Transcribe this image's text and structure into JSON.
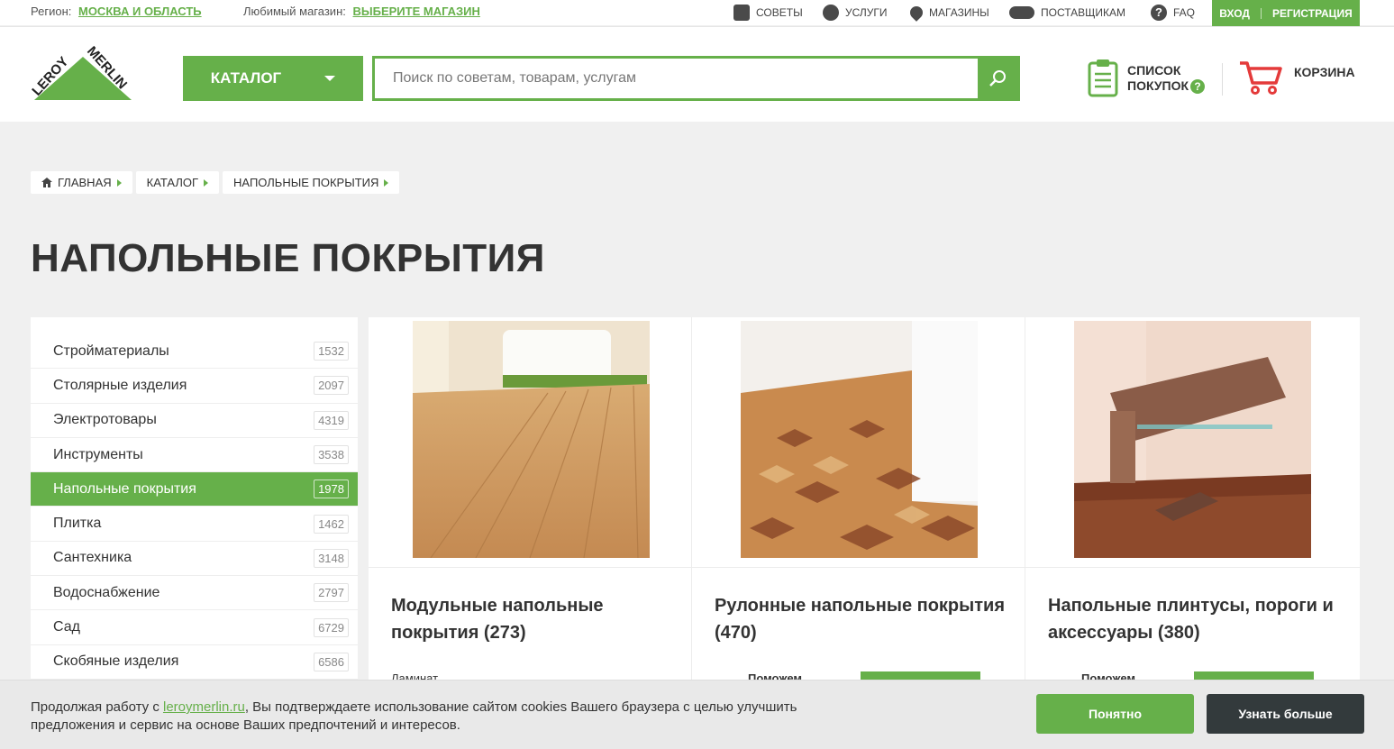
{
  "topbar": {
    "region_label": "Регион:",
    "region_value": "МОСКВА И ОБЛАСТЬ",
    "store_label": "Любимый магазин:",
    "store_value": "ВЫБЕРИТЕ МАГАЗИН",
    "nav": [
      {
        "label": "СОВЕТЫ",
        "icon": "tips-icon"
      },
      {
        "label": "УСЛУГИ",
        "icon": "gear-icon"
      },
      {
        "label": "МАГАЗИНЫ",
        "icon": "location-pin-icon"
      },
      {
        "label": "ПОСТАВЩИКАМ",
        "icon": "handshake-icon"
      },
      {
        "label": "FAQ",
        "icon": "question-icon"
      }
    ],
    "login": "ВХОД",
    "register": "РЕГИСТРАЦИЯ"
  },
  "header": {
    "logo_text_1": "LEROY",
    "logo_text_2": "MERLIN",
    "catalog_label": "КАТАЛОГ",
    "search_placeholder": "Поиск по советам, товарам, услугам",
    "shopping_list_line1": "СПИСОК",
    "shopping_list_line2": "ПОКУПОК",
    "shopping_list_help": "?",
    "cart_label": "КОРЗИНА"
  },
  "breadcrumb": [
    "ГЛАВНАЯ",
    "КАТАЛОГ",
    "НАПОЛЬНЫЕ ПОКРЫТИЯ"
  ],
  "page_title": "НАПОЛЬНЫЕ ПОКРЫТИЯ",
  "sidebar": {
    "items": [
      {
        "label": "Стройматериалы",
        "count": "1532"
      },
      {
        "label": "Столярные изделия",
        "count": "2097"
      },
      {
        "label": "Электротовары",
        "count": "4319"
      },
      {
        "label": "Инструменты",
        "count": "3538"
      },
      {
        "label": "Напольные покрытия",
        "count": "1978",
        "active": true
      },
      {
        "label": "Плитка",
        "count": "1462"
      },
      {
        "label": "Сантехника",
        "count": "3148"
      },
      {
        "label": "Водоснабжение",
        "count": "2797"
      },
      {
        "label": "Сад",
        "count": "6729"
      },
      {
        "label": "Скобяные изделия",
        "count": "6586"
      }
    ]
  },
  "cards": [
    {
      "title_line1": "Модульные напольные",
      "title_line2": "покрытия (273)",
      "sub": "Ламинат"
    },
    {
      "title_line1": "Рулонные напольные покрытия",
      "title_line2": "(470)",
      "sub": "Поможем"
    },
    {
      "title_line1": "Напольные плинтусы, пороги и",
      "title_line2": "аксессуары (380)",
      "sub": "Поможем"
    }
  ],
  "cookie": {
    "text_before": "Продолжая работу с ",
    "link": "leroymerlin.ru",
    "text_after": ", Вы подтверждаете использование сайтом cookies Вашего браузера с целью улучшить предложения и сервис на основе Ваших предпочтений и интересов.",
    "ok_label": "Понятно",
    "more_label": "Узнать больше"
  },
  "colors": {
    "brand_green": "#66b04a",
    "dark_button": "#333a3c",
    "page_bg": "#f0f0f0"
  }
}
